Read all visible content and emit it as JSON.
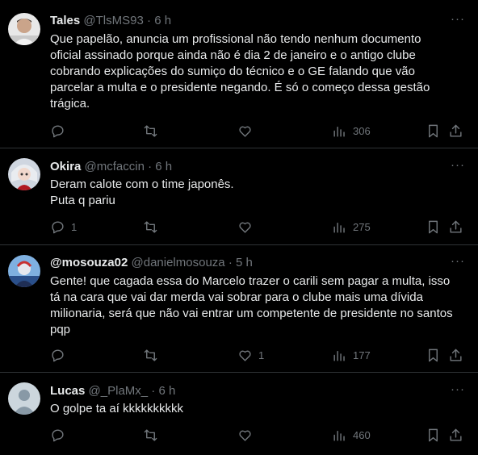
{
  "tweets": [
    {
      "name": "Tales",
      "handle": "@TlsMS93",
      "dot": "·",
      "time": "6 h",
      "text": "Que papelão, anuncia um profissional não tendo nenhum documento\noficial assinado porque ainda não é dia 2 de janeiro e o antigo clube\ncobrando explicações do sumiço do técnico e o GE falando que vão\nparcelar a multa e o presidente negando. É só o começo dessa gestão\ntrágica.",
      "replies": "",
      "retweets": "",
      "likes": "",
      "views": "306"
    },
    {
      "name": "Okira",
      "handle": "@mcfaccin",
      "dot": "·",
      "time": "6 h",
      "text": "Deram calote com o time japonês.\nPuta q pariu",
      "replies": "1",
      "retweets": "",
      "likes": "",
      "views": "275"
    },
    {
      "name": "@mosouza02",
      "handle": "@danielmosouza",
      "dot": "·",
      "time": "5 h",
      "text": "Gente! que cagada essa do Marcelo trazer o carili sem pagar a multa, isso\ntá na cara que vai dar merda vai sobrar para o clube mais uma dívida\nmilionaria, será que não vai entrar um competente de presidente no santos\npqp",
      "replies": "",
      "retweets": "",
      "likes": "1",
      "views": "177"
    },
    {
      "name": "Lucas",
      "handle": "@_PlaMx_",
      "dot": "·",
      "time": "6 h",
      "text": "O golpe ta aí kkkkkkkkkk",
      "replies": "",
      "retweets": "",
      "likes": "",
      "views": "460"
    }
  ],
  "more_glyph": "···",
  "colors": {
    "background": "#000000",
    "text": "#e7e9ea",
    "secondary": "#71767b",
    "divider": "#2f3336"
  },
  "icons": [
    "reply-icon",
    "retweet-icon",
    "like-icon",
    "views-icon",
    "bookmark-icon",
    "share-icon"
  ]
}
